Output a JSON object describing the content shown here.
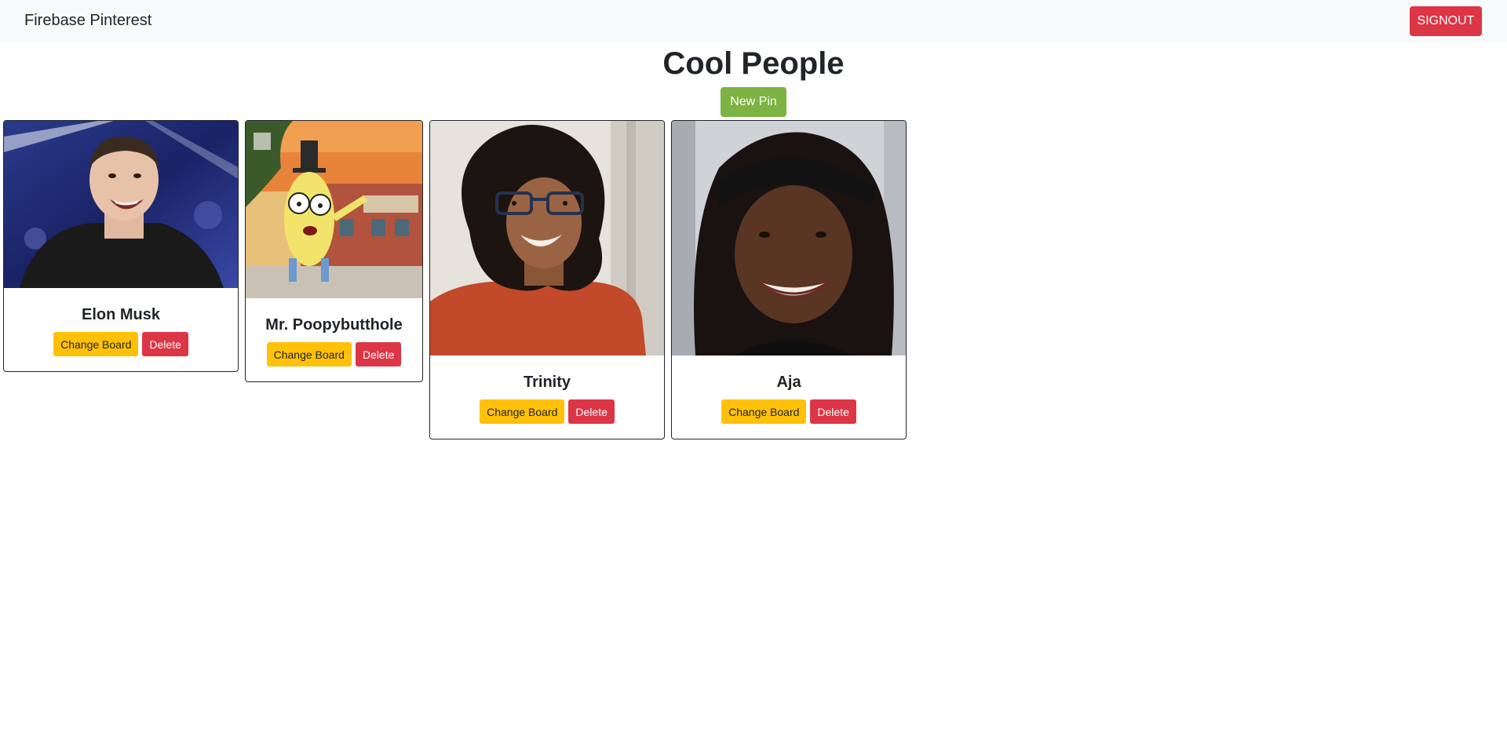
{
  "navbar": {
    "brand": "Firebase Pinterest",
    "signout_label": "SIGNOUT"
  },
  "board": {
    "title": "Cool People",
    "new_pin_label": "New Pin"
  },
  "pins": [
    {
      "name": "Elon Musk",
      "change_label": "Change Board",
      "delete_label": "Delete"
    },
    {
      "name": "Mr. Poopybutthole",
      "change_label": "Change Board",
      "delete_label": "Delete"
    },
    {
      "name": "Trinity",
      "change_label": "Change Board",
      "delete_label": "Delete"
    },
    {
      "name": "Aja",
      "change_label": "Change Board",
      "delete_label": "Delete"
    }
  ],
  "colors": {
    "navbar_bg": "#f8f9fa",
    "signout": "#dc3545",
    "new_pin": "#7cb342",
    "change_board": "#ffc107",
    "delete": "#dc3545"
  }
}
